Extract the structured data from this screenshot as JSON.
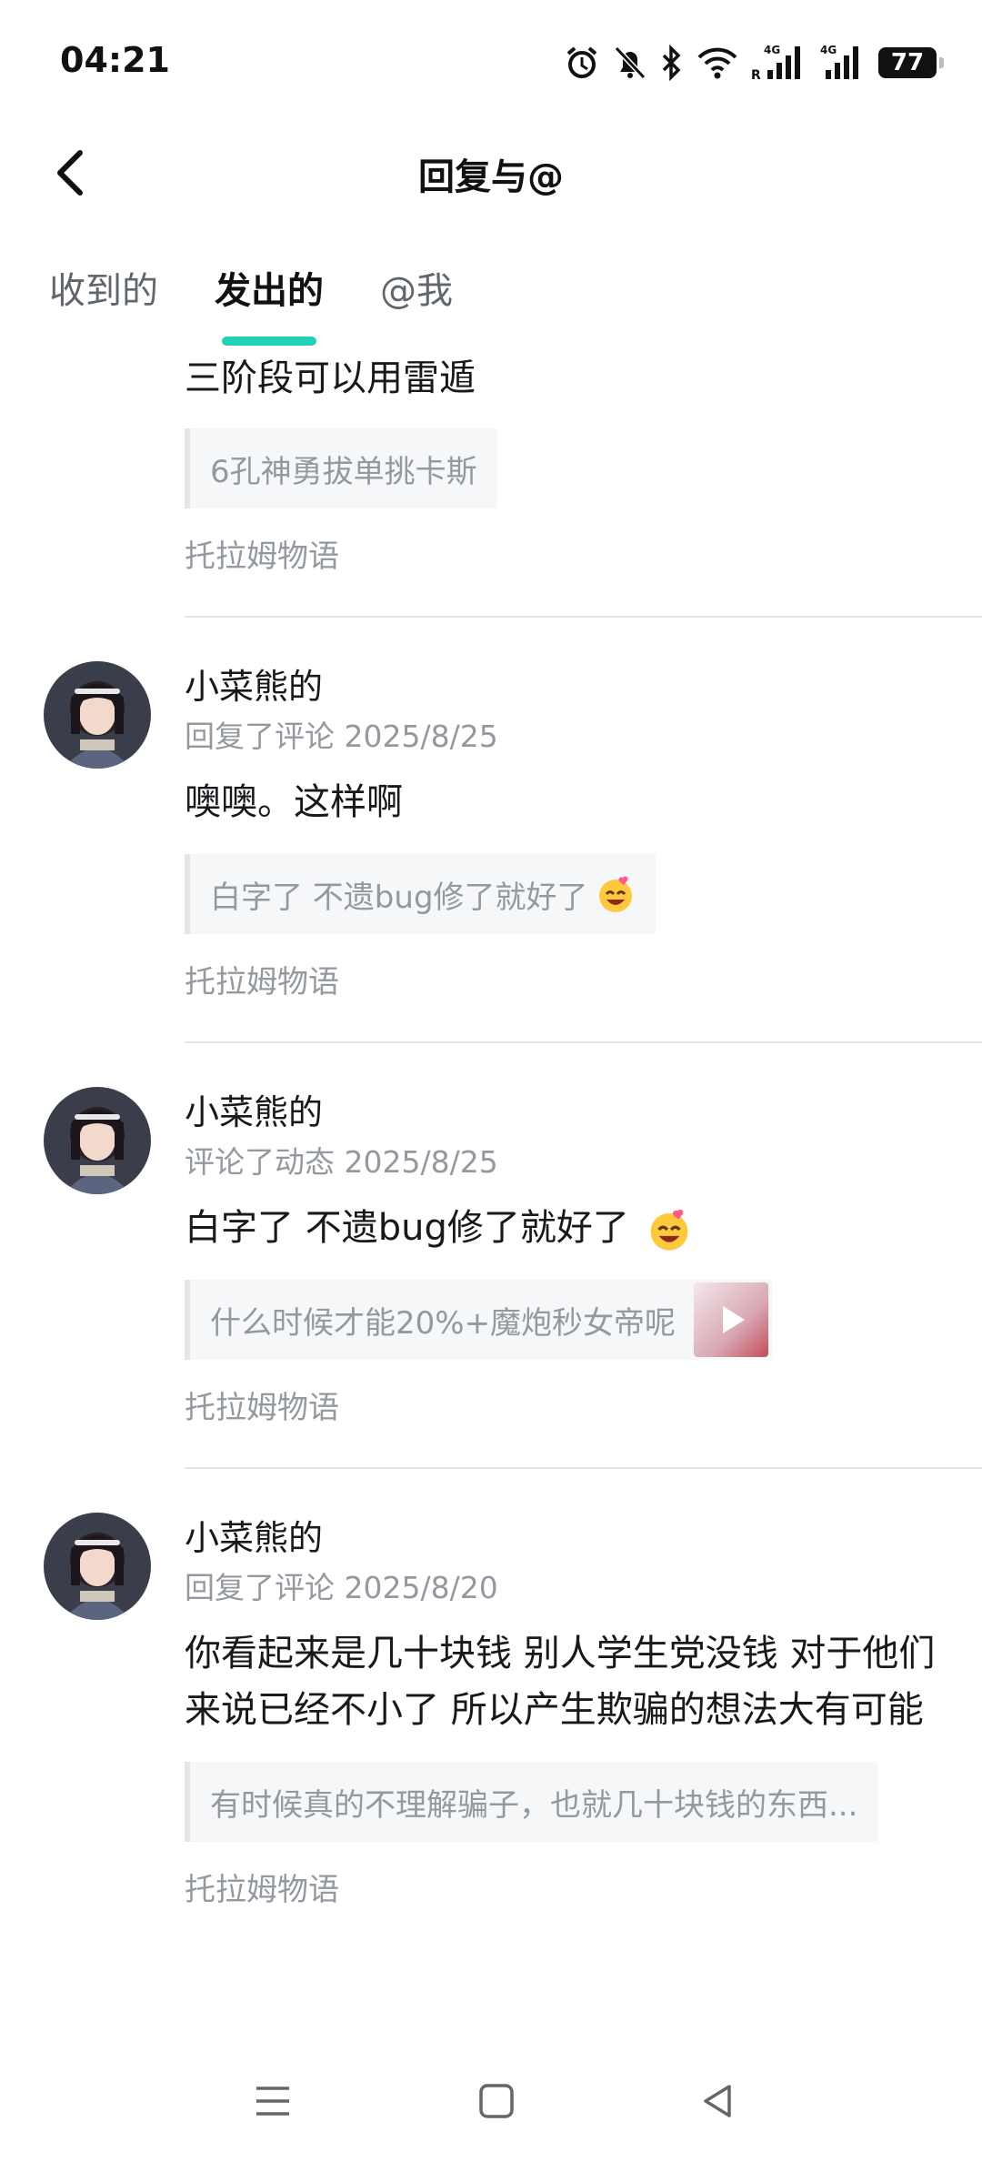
{
  "status": {
    "time": "04:21",
    "battery": "77",
    "net1": "4G",
    "net2": "4G",
    "roaming": "R"
  },
  "header": {
    "title": "回复与@"
  },
  "tabs": [
    {
      "label": "收到的",
      "active": false
    },
    {
      "label": "发出的",
      "active": true
    },
    {
      "label": "@我",
      "active": false
    }
  ],
  "partial_item": {
    "body": "三阶段可以用雷遁",
    "quote": "6孔神勇拔单挑卡斯",
    "source": "托拉姆物语"
  },
  "items": [
    {
      "name": "小菜熊的",
      "meta": "回复了评论 2025/8/25",
      "body": "噢噢。这样啊",
      "quote": "白字了 不遗bug修了就好了",
      "quote_emoji": "grinning-hearts-emoji",
      "source": "托拉姆物语"
    },
    {
      "name": "小菜熊的",
      "meta": "评论了动态 2025/8/25",
      "body": "白字了 不遗bug修了就好了",
      "body_emoji": "grinning-hearts-emoji",
      "quote": "什么时候才能20%+魔炮秒女帝呢",
      "quote_thumb": "video-thumbnail",
      "source": "托拉姆物语"
    },
    {
      "name": "小菜熊的",
      "meta": "回复了评论 2025/8/20",
      "body": "你看起来是几十块钱 别人学生党没钱 对于他们来说已经不小了 所以产生欺骗的想法大有可能",
      "quote": "有时候真的不理解骗子，也就几十块钱的东西...",
      "source": "托拉姆物语"
    }
  ],
  "nav": {
    "menu_icon": "menu-icon",
    "home_icon": "home-icon",
    "back_icon": "back-triangle-icon"
  },
  "colors": {
    "accent": "#1fd1b5",
    "text": "#18191c",
    "secondary": "#9499a0"
  }
}
